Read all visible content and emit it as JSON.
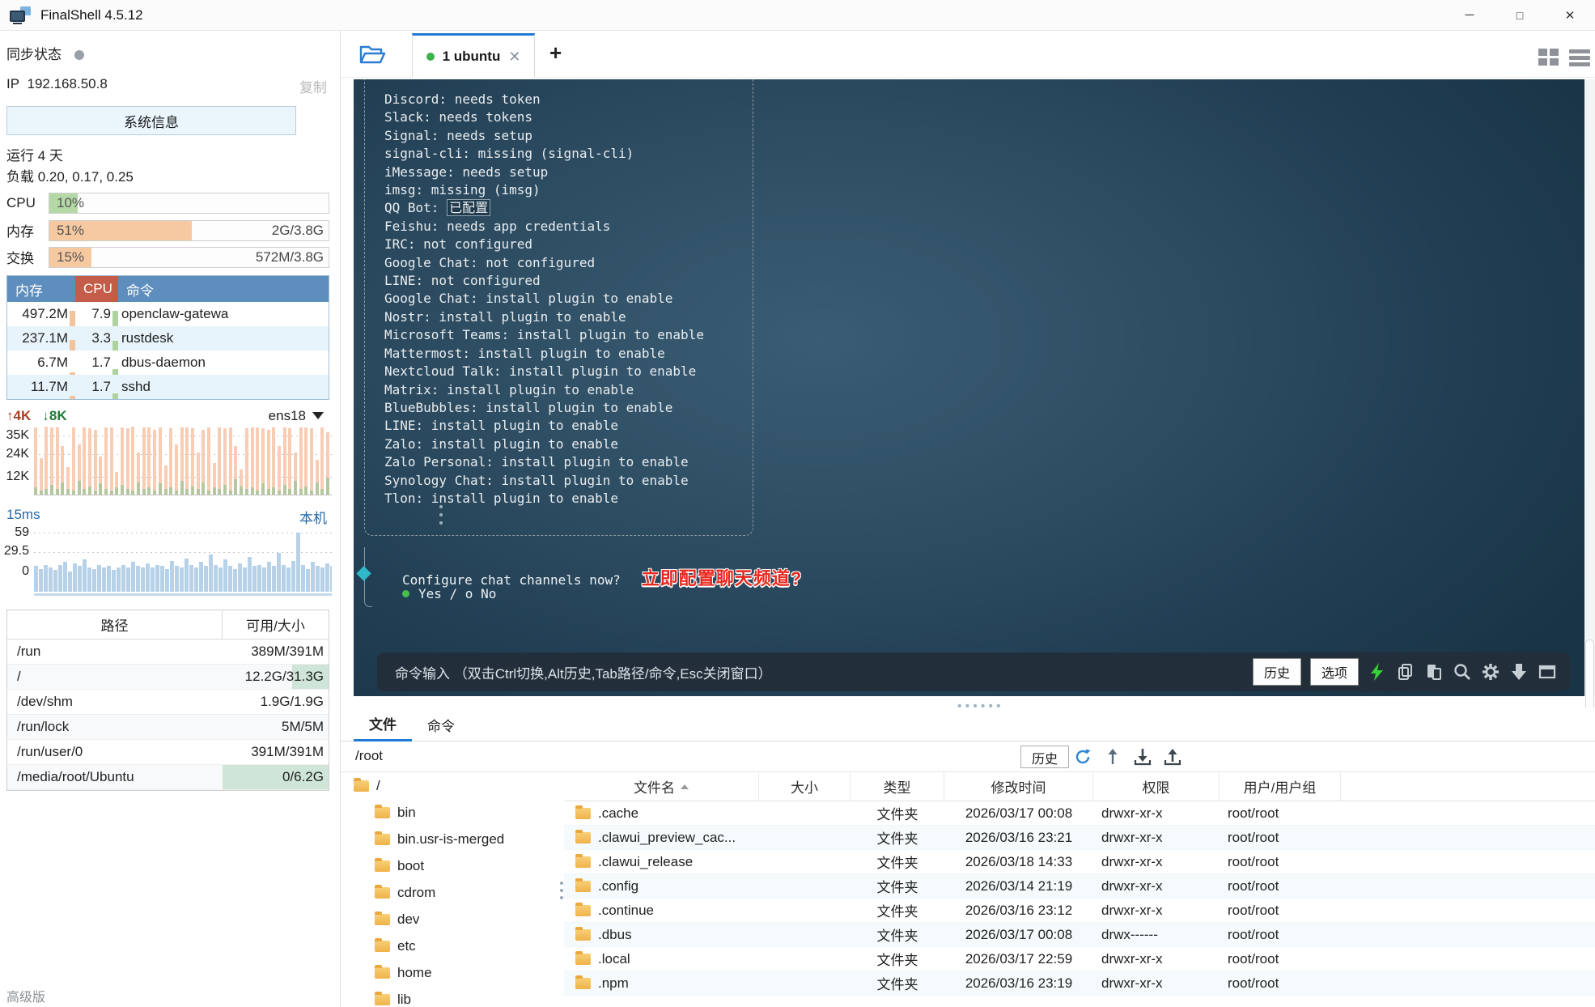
{
  "window": {
    "title": "FinalShell 4.5.12",
    "controls": {
      "minimize": "─",
      "maximize": "□",
      "close": "✕"
    }
  },
  "sidebar": {
    "sync_label": "同步状态",
    "ip_label": "IP",
    "ip": "192.168.50.8",
    "copy_label": "复制",
    "sysinfo_button": "系统信息",
    "uptime": "运行 4 天",
    "load": "负载 0.20, 0.17, 0.25",
    "cpu": {
      "label": "CPU",
      "percent": "10%",
      "value": 10
    },
    "mem": {
      "label": "内存",
      "percent": "51%",
      "value": 51,
      "detail": "2G/3.8G"
    },
    "swap": {
      "label": "交换",
      "percent": "15%",
      "value": 15,
      "detail": "572M/3.8G"
    },
    "process_table": {
      "headers": [
        "内存",
        "CPU",
        "命令"
      ],
      "rows": [
        {
          "mem": "497.2M",
          "mem_bar": 65,
          "cpu": "7.9",
          "cpu_bar": 65,
          "cmd": "openclaw-gatewa"
        },
        {
          "mem": "237.1M",
          "mem_bar": 45,
          "cpu": "3.3",
          "cpu_bar": 40,
          "cmd": "rustdesk"
        },
        {
          "mem": "6.7M",
          "mem_bar": 10,
          "cpu": "1.7",
          "cpu_bar": 22,
          "cmd": "dbus-daemon"
        },
        {
          "mem": "11.7M",
          "mem_bar": 12,
          "cpu": "1.7",
          "cpu_bar": 22,
          "cmd": "sshd"
        }
      ]
    },
    "network": {
      "up": "4K",
      "down": "8K",
      "iface": "ens18",
      "y_labels": [
        "35K",
        "24K",
        "12K"
      ],
      "bars": [
        [
          96,
          10
        ],
        [
          52,
          6
        ],
        [
          98,
          8
        ],
        [
          97,
          14
        ],
        [
          96,
          8
        ],
        [
          70,
          18
        ],
        [
          40,
          8
        ],
        [
          96,
          6
        ],
        [
          72,
          20
        ],
        [
          97,
          8
        ],
        [
          95,
          12
        ],
        [
          93,
          6
        ],
        [
          55,
          16
        ],
        [
          96,
          8
        ],
        [
          97,
          6
        ],
        [
          32,
          10
        ],
        [
          96,
          14
        ],
        [
          95,
          8
        ],
        [
          98,
          6
        ],
        [
          60,
          18
        ],
        [
          96,
          8
        ],
        [
          97,
          10
        ],
        [
          93,
          6
        ],
        [
          96,
          16
        ],
        [
          42,
          8
        ],
        [
          95,
          10
        ],
        [
          72,
          6
        ],
        [
          96,
          20
        ],
        [
          97,
          8
        ],
        [
          95,
          12
        ],
        [
          60,
          8
        ],
        [
          93,
          18
        ],
        [
          97,
          6
        ],
        [
          45,
          10
        ],
        [
          96,
          8
        ],
        [
          95,
          14
        ],
        [
          97,
          6
        ],
        [
          70,
          22
        ],
        [
          36,
          12
        ],
        [
          95,
          8
        ],
        [
          96,
          10
        ],
        [
          97,
          6
        ],
        [
          95,
          16
        ],
        [
          93,
          8
        ],
        [
          96,
          10
        ],
        [
          70,
          6
        ],
        [
          97,
          14
        ],
        [
          95,
          8
        ],
        [
          60,
          20
        ],
        [
          96,
          8
        ],
        [
          97,
          12
        ],
        [
          95,
          6
        ],
        [
          50,
          18
        ],
        [
          96,
          8
        ],
        [
          90,
          24
        ]
      ]
    },
    "ping": {
      "latency": "15ms",
      "host": "本机",
      "y_labels": [
        "59",
        "29.5",
        "0"
      ],
      "points": [
        38,
        34,
        40,
        36,
        33,
        40,
        44,
        30,
        42,
        38,
        48,
        36,
        34,
        40,
        36,
        38,
        33,
        36,
        40,
        36,
        44,
        38,
        36,
        42,
        36,
        40,
        38,
        34,
        46,
        38,
        36,
        50,
        40,
        36,
        44,
        38,
        55,
        40,
        36,
        48,
        38,
        34,
        42,
        36,
        52,
        38,
        40,
        36,
        44,
        38,
        58,
        40,
        36,
        46,
        88,
        40,
        34,
        44,
        38,
        36,
        42,
        38
      ]
    },
    "disk_table": {
      "headers": [
        "路径",
        "可用/大小"
      ],
      "rows": [
        {
          "path": "/run",
          "value": "389M/391M",
          "fill": 0
        },
        {
          "path": "/",
          "value": "12.2G/31.3G",
          "fill": 34
        },
        {
          "path": "/dev/shm",
          "value": "1.9G/1.9G",
          "fill": 0
        },
        {
          "path": "/run/lock",
          "value": "5M/5M",
          "fill": 0
        },
        {
          "path": "/run/user/0",
          "value": "391M/391M",
          "fill": 0
        },
        {
          "path": "/media/root/Ubuntu",
          "value": "0/6.2G",
          "fill": 100
        }
      ]
    },
    "edition": "高级版"
  },
  "tabbar": {
    "tab_label": "1 ubuntu",
    "close": "✕",
    "new_tab": "+"
  },
  "terminal": {
    "lines": [
      "Discord: needs token",
      "Slack: needs tokens",
      "Signal: needs setup",
      "signal-cli: missing (signal-cli)",
      "iMessage: needs setup",
      "imsg: missing (imsg)",
      {
        "pre": "QQ Bot: ",
        "badge": "已配置"
      },
      "Feishu: needs app credentials",
      "IRC: not configured",
      "Google Chat: not configured",
      "LINE: not configured",
      "Google Chat: install plugin to enable",
      "Nostr: install plugin to enable",
      "Microsoft Teams: install plugin to enable",
      "Mattermost: install plugin to enable",
      "Nextcloud Talk: install plugin to enable",
      "Matrix: install plugin to enable",
      "BlueBubbles: install plugin to enable",
      "LINE: install plugin to enable",
      "Zalo: install plugin to enable",
      "Zalo Personal: install plugin to enable",
      "Synology Chat: install plugin to enable",
      "Tlon: install plugin to enable"
    ],
    "prompt": {
      "question": "Configure chat channels now?",
      "annotation": "立即配置聊天频道?",
      "answers": "Yes / o No"
    },
    "statusbar": {
      "hint": "命令输入 （双击Ctrl切换,Alt历史,Tab路径/命令,Esc关闭窗口）",
      "history": "历史",
      "options": "选项"
    }
  },
  "filepanel": {
    "tabs": [
      {
        "label": "文件",
        "active": true
      },
      {
        "label": "命令",
        "active": false
      }
    ],
    "path": "/root",
    "history_button": "历史",
    "tree": {
      "root": "/",
      "items": [
        "bin",
        "bin.usr-is-merged",
        "boot",
        "cdrom",
        "dev",
        "etc",
        "home",
        "lib"
      ]
    },
    "table": {
      "headers": [
        "文件名",
        "大小",
        "类型",
        "修改时间",
        "权限",
        "用户/用户组"
      ],
      "rows": [
        {
          "name": ".cache",
          "size": "",
          "type": "文件夹",
          "mtime": "2026/03/17 00:08",
          "perm": "drwxr-xr-x",
          "owner": "root/root"
        },
        {
          "name": ".clawui_preview_cac...",
          "size": "",
          "type": "文件夹",
          "mtime": "2026/03/16 23:21",
          "perm": "drwxr-xr-x",
          "owner": "root/root"
        },
        {
          "name": ".clawui_release",
          "size": "",
          "type": "文件夹",
          "mtime": "2026/03/18 14:33",
          "perm": "drwxr-xr-x",
          "owner": "root/root"
        },
        {
          "name": ".config",
          "size": "",
          "type": "文件夹",
          "mtime": "2026/03/14 21:19",
          "perm": "drwxr-xr-x",
          "owner": "root/root"
        },
        {
          "name": ".continue",
          "size": "",
          "type": "文件夹",
          "mtime": "2026/03/16 23:12",
          "perm": "drwxr-xr-x",
          "owner": "root/root"
        },
        {
          "name": ".dbus",
          "size": "",
          "type": "文件夹",
          "mtime": "2026/03/17 00:08",
          "perm": "drwx------",
          "owner": "root/root"
        },
        {
          "name": ".local",
          "size": "",
          "type": "文件夹",
          "mtime": "2026/03/17 22:59",
          "perm": "drwxr-xr-x",
          "owner": "root/root"
        },
        {
          "name": ".npm",
          "size": "",
          "type": "文件夹",
          "mtime": "2026/03/16 23:19",
          "perm": "drwxr-xr-x",
          "owner": "root/root"
        }
      ]
    }
  },
  "colors": {
    "accent": "#1f7bd6",
    "annotation_red": "#e8281e",
    "header_blue": "#5e8ebd",
    "header_red": "#c35d49",
    "bar_green": "#b4d9a5",
    "bar_orange": "#f7c9a0",
    "net_salmon": "#f8cdb4",
    "ping_blue": "#b7d2e8"
  }
}
